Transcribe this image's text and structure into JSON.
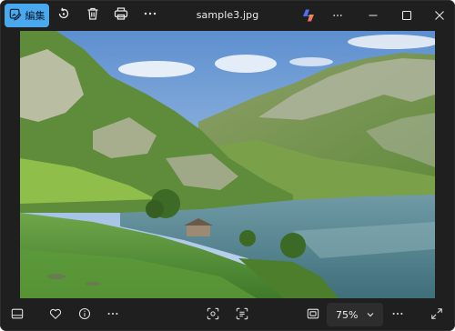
{
  "app": {
    "file_name": "sample3.jpg"
  },
  "toolbar": {
    "edit_label": "編集",
    "edit_icon": "edit-image-icon",
    "rotate_icon": "rotate-icon",
    "delete_icon": "trash-icon",
    "print_icon": "printer-icon",
    "more_icon": "more-icon",
    "copilot_icon": "copilot-icon",
    "accent_color": "#4aa8ef"
  },
  "window_controls": {
    "more_icon": "more-icon",
    "minimize_icon": "minimize-icon",
    "maximize_icon": "maximize-icon",
    "close_icon": "close-icon"
  },
  "bottom_bar": {
    "filmstrip_icon": "filmstrip-icon",
    "favorite_icon": "heart-icon",
    "info_icon": "info-icon",
    "more_icon": "more-icon",
    "visual_search_icon": "visual-search-icon",
    "text_recognition_icon": "text-scan-icon",
    "fit_icon": "fit-to-window-icon",
    "zoom_level": "75%",
    "zoom_more_icon": "more-icon",
    "fullscreen_icon": "fullscreen-icon"
  }
}
